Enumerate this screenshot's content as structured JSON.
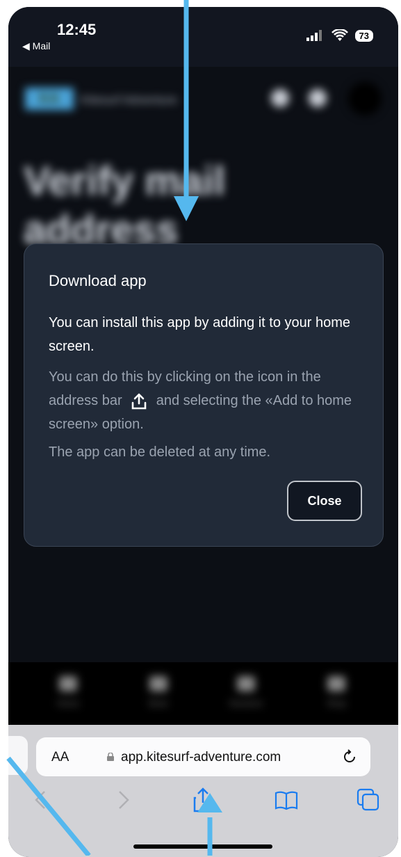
{
  "status_bar": {
    "time": "12:45",
    "back_label": "◀ Mail",
    "battery": "73"
  },
  "background_page": {
    "logo_text": "KA",
    "brand": "Kitesurf Adventure",
    "title": "Verify mail address",
    "nav": [
      "Home",
      "Book",
      "Sessions",
      "Shop"
    ]
  },
  "modal": {
    "title": "Download app",
    "main_text": "You can install this app by adding it to your home screen.",
    "secondary_before_icon": "You can do this by clicking on the icon in the address bar",
    "secondary_after_icon": "and selecting the «Add to home screen» option.",
    "note": "The app can be deleted at any time.",
    "close_label": "Close"
  },
  "safari": {
    "aa_label": "AA",
    "url": "app.kitesurf-adventure.com",
    "toolbar_icons": [
      "back-arrow-icon",
      "forward-arrow-icon",
      "share-icon",
      "bookmarks-icon",
      "tabs-icon"
    ]
  },
  "colors": {
    "modal_bg": "#212a38",
    "arrow": "#55b8ee",
    "safari_bar": "#d2d2d6"
  }
}
